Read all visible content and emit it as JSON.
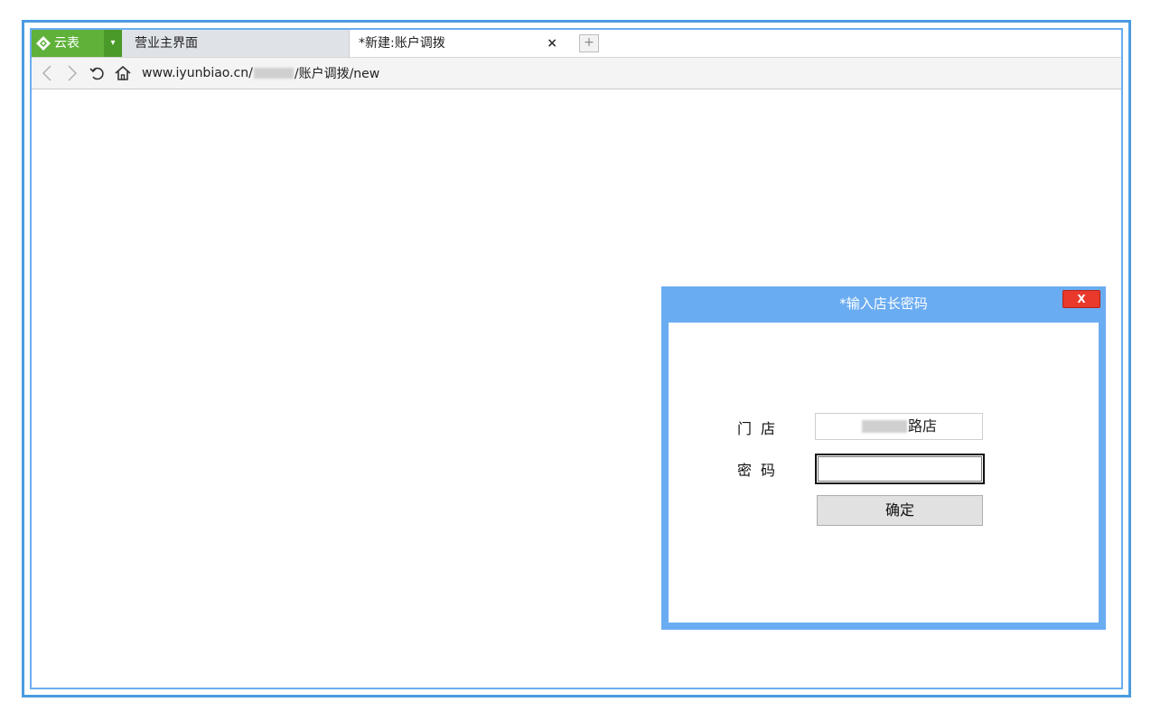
{
  "browser": {
    "brand_label": "云表",
    "tabs": [
      {
        "label": "营业主界面",
        "active": false
      },
      {
        "label": "*新建:账户调拨",
        "active": true
      }
    ],
    "close_tab_glyph": "×",
    "new_tab_glyph": "+",
    "url_prefix": "www.iyunbiao.cn/",
    "url_suffix": "/账户调拨/new"
  },
  "dialog": {
    "title": "*输入店长密码",
    "close_label": "X",
    "store_label": "门店",
    "store_value_suffix": "路店",
    "password_label": "密码",
    "password_value": "",
    "confirm_label": "确定"
  },
  "colors": {
    "frame_border": "#4a9be0",
    "brand_green": "#5fb13a",
    "dialog_blue": "#6aacf2",
    "close_red": "#e8392c"
  }
}
